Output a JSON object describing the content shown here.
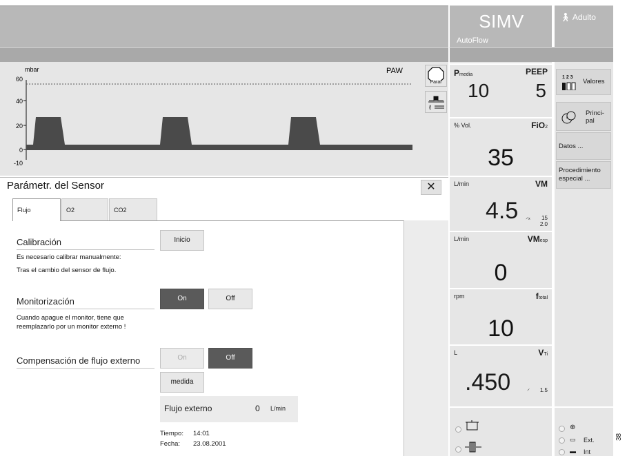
{
  "header": {
    "mode": "SIMV",
    "mode_sub": "AutoFlow",
    "patient": "Adulto"
  },
  "waveform": {
    "unit": "mbar",
    "signal": "PAW",
    "y_ticks": [
      "60",
      "40",
      "20",
      "0",
      "-10"
    ],
    "stop_label": "Parar"
  },
  "dialog": {
    "title": "Parámetr. del Sensor",
    "close_symbol": "✕",
    "tabs": [
      "Flujo",
      "O2",
      "CO2"
    ],
    "calibration": {
      "title": "Calibración",
      "button": "Inicio",
      "text_line1": "Es necesario calibrar manualmente:",
      "text_line2": "Tras el cambio del sensor de flujo."
    },
    "monitoring": {
      "title": "Monitorización",
      "on": "On",
      "off": "Off",
      "text_line1": "Cuando apague el monitor, tiene que",
      "text_line2": "reemplazarlo por un monitor externo !"
    },
    "external_flow": {
      "title": "Compensación de flujo externo",
      "on": "On",
      "off": "Off",
      "measure_button": "medida",
      "value_label": "Flujo externo",
      "value": "0",
      "unit": "L/min"
    },
    "time_label": "Tiempo:",
    "time_value": "14:01",
    "date_label": "Fecha:",
    "date_value": "23.08.2001"
  },
  "values": {
    "pmean": {
      "name": "P",
      "sub": "media",
      "value": "10"
    },
    "peep": {
      "name": "PEEP",
      "value": "5"
    },
    "fio2": {
      "unit": "% Vol.",
      "name": "FiO",
      "sub": "2",
      "value": "35"
    },
    "mv": {
      "unit": "L/min",
      "name": "VM",
      "value": "4.5",
      "lim_hi": "15",
      "lim_lo": "2.0"
    },
    "mvspont": {
      "unit": "L/min",
      "name": "VM",
      "sub": "esp",
      "value": "0"
    },
    "ftotal": {
      "unit": "rpm",
      "name": "f",
      "sub": "total",
      "value": "10"
    },
    "vti": {
      "unit": "L",
      "name": "V",
      "sub": "Ti",
      "value": ".450",
      "lim": "1.5"
    }
  },
  "side_buttons": {
    "values": "Valores",
    "values_icon_text": "1 2 3",
    "main": "Princi-\npal",
    "data": "Datos ...",
    "special": "Procedimiento especial ..."
  },
  "status": {
    "ext": "Ext.",
    "int": "Int"
  },
  "side_code": "38"
}
